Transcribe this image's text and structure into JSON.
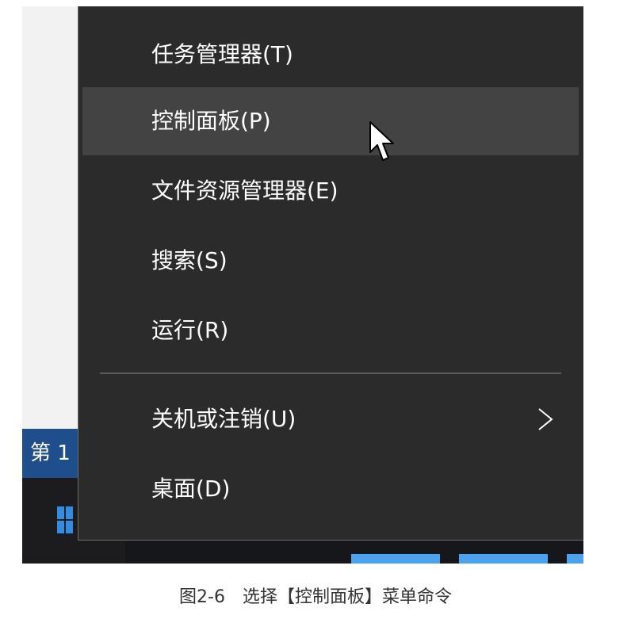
{
  "background_window": {
    "doc_tab_text": "第 1"
  },
  "taskbar": {
    "start_icon": "windows-logo-icon"
  },
  "context_menu": {
    "items": [
      {
        "label": "任务管理器(T)"
      },
      {
        "label": "控制面板(P)",
        "highlighted": true
      },
      {
        "label": "文件资源管理器(E)"
      },
      {
        "label": "搜索(S)"
      },
      {
        "label": "运行(R)"
      },
      {
        "label": "关机或注销(U)",
        "has_submenu": true,
        "submenu_icon": "chevron-right-icon"
      },
      {
        "label": "桌面(D)"
      }
    ]
  },
  "cursor_icon": "mouse-pointer-icon",
  "caption": "图2-6　选择【控制面板】菜单命令",
  "colors": {
    "menu_bg": "#2b2b2b",
    "menu_highlight": "#434343",
    "menu_text": "#ffffff",
    "taskbar_bg": "#16171b",
    "accent": "#2f8de4",
    "doc_tab_bg": "#1e4e8c"
  }
}
